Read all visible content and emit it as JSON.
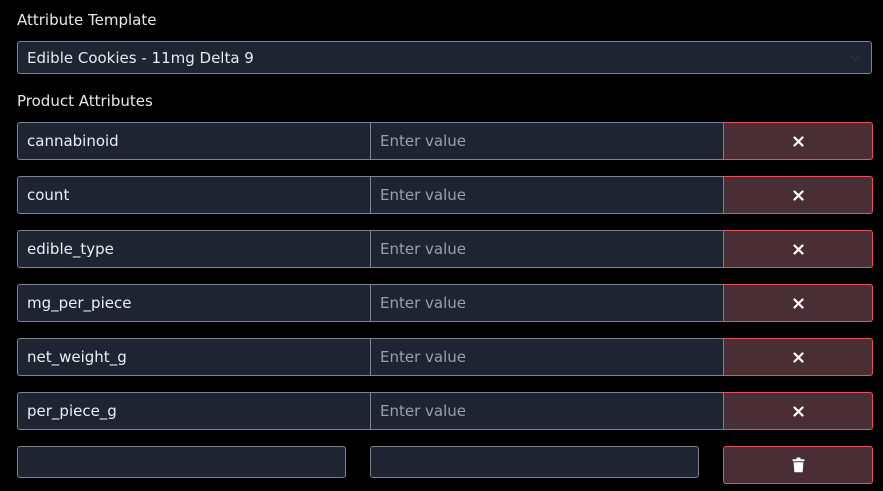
{
  "template": {
    "label": "Attribute Template",
    "selected": "Edible Cookies - 11mg Delta 9",
    "chevron_icon": "chevron-down-icon"
  },
  "attributes": {
    "label": "Product Attributes",
    "rows": [
      {
        "key": "cannabinoid",
        "value": "",
        "placeholder": "Enter value"
      },
      {
        "key": "count",
        "value": "",
        "placeholder": "Enter value"
      },
      {
        "key": "edible_type",
        "value": "",
        "placeholder": "Enter value"
      },
      {
        "key": "mg_per_piece",
        "value": "",
        "placeholder": "Enter value"
      },
      {
        "key": "net_weight_g",
        "value": "",
        "placeholder": "Enter value"
      },
      {
        "key": "per_piece_g",
        "value": "",
        "placeholder": "Enter value"
      }
    ],
    "remove_icon": "close-icon",
    "new_row": {
      "key": "",
      "value": "",
      "delete_icon": "trash-icon"
    }
  },
  "colors": {
    "background": "#000000",
    "field_bg": "#1f2433",
    "field_border": "#7a8296",
    "danger_bg": "#4a2e35",
    "danger_border": "#e2545b"
  }
}
